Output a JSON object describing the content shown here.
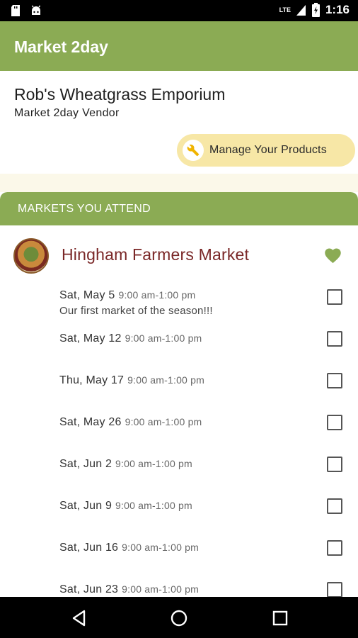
{
  "status_bar": {
    "network": "LTE",
    "time": "1:16"
  },
  "app_bar": {
    "title": "Market 2day"
  },
  "vendor": {
    "name": "Rob's Wheatgrass Emporium",
    "subtitle": "Market 2day Vendor",
    "manage_button_label": "Manage Your Products"
  },
  "markets": {
    "header": "MARKETS YOU ATTEND",
    "market_name": "Hingham Farmers Market",
    "dates": [
      {
        "day": "Sat, May 5",
        "time": "9:00 am-1:00 pm",
        "note": "Our first market of the season!!!"
      },
      {
        "day": "Sat, May 12",
        "time": "9:00 am-1:00 pm"
      },
      {
        "day": "Thu, May 17",
        "time": "9:00 am-1:00 pm"
      },
      {
        "day": "Sat, May 26",
        "time": "9:00 am-1:00 pm"
      },
      {
        "day": "Sat, Jun 2",
        "time": "9:00 am-1:00 pm"
      },
      {
        "day": "Sat, Jun 9",
        "time": "9:00 am-1:00 pm"
      },
      {
        "day": "Sat, Jun 16",
        "time": "9:00 am-1:00 pm"
      },
      {
        "day": "Sat, Jun 23",
        "time": "9:00 am-1:00 pm"
      }
    ]
  },
  "colors": {
    "primary_green": "#8bab54",
    "accent_yellow": "#f7e7a6",
    "market_name": "#7a2727",
    "heart": "#8bab54"
  },
  "icons": {
    "status_left": [
      "sd-card-icon",
      "android-icon"
    ],
    "status_right": [
      "lte-signal-icon",
      "battery-icon"
    ],
    "manage_button": "wrench-icon",
    "favorite": "heart-icon",
    "nav": [
      "back-icon",
      "home-icon",
      "recents-icon"
    ]
  }
}
